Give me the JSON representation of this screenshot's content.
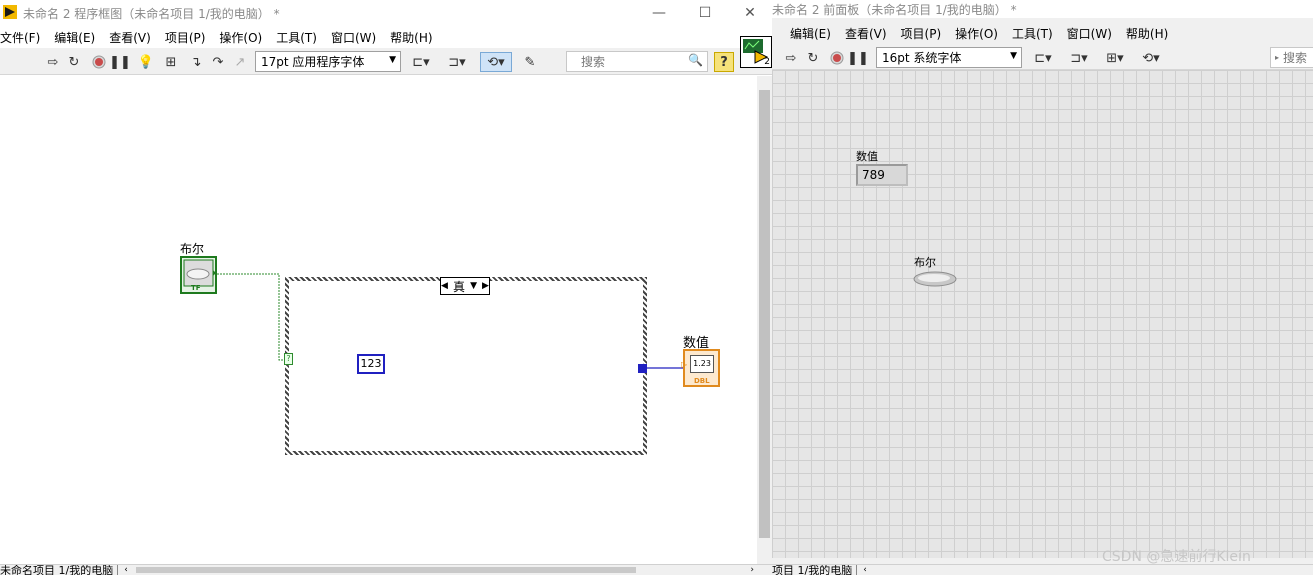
{
  "left_window": {
    "title": "未命名 2 程序框图（未命名项目 1/我的电脑）  *",
    "menu": [
      "文件(F)",
      "编辑(E)",
      "查看(V)",
      "项目(P)",
      "操作(O)",
      "工具(T)",
      "窗口(W)",
      "帮助(H)"
    ],
    "font_select": "17pt 应用程序字体",
    "search_placeholder": "搜索",
    "bool_label": "布尔",
    "bool_terminal": "TF",
    "case_selector": "真",
    "case_terminal": "?",
    "constant_value": "123",
    "numeric_label": "数值",
    "numeric_terminal_value": "1.23",
    "numeric_terminal_type": "DBL",
    "status_path": "未命名项目 1/我的电脑",
    "connector_pane_number": "2"
  },
  "right_window": {
    "title": "未命名 2 前面板（未命名项目 1/我的电脑）  *",
    "menu": [
      "编辑(E)",
      "查看(V)",
      "项目(P)",
      "操作(O)",
      "工具(T)",
      "窗口(W)",
      "帮助(H)"
    ],
    "font_select": "16pt 系统字体",
    "numeric_label": "数值",
    "numeric_value": "789",
    "bool_label": "布尔",
    "status_path": "项目 1/我的电脑"
  },
  "watermark": "CSDN @急速前行Klein"
}
